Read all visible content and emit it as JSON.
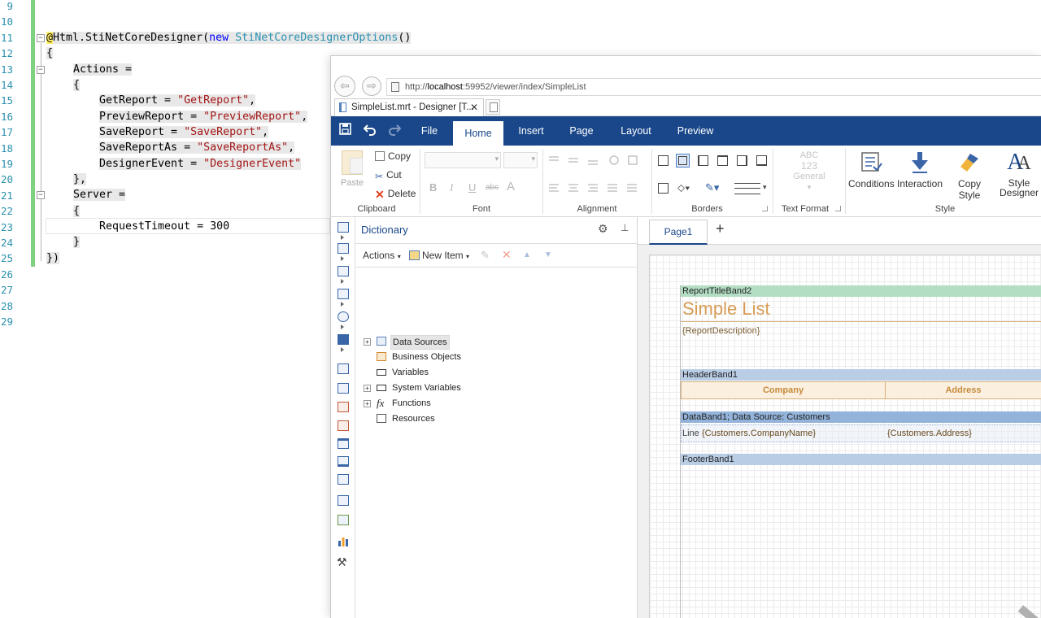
{
  "editor": {
    "line_numbers": [
      "9",
      "10",
      "11",
      "12",
      "13",
      "14",
      "15",
      "16",
      "17",
      "18",
      "19",
      "20",
      "21",
      "22",
      "23",
      "24",
      "25",
      "26",
      "27",
      "28",
      "29"
    ],
    "code": {
      "l11_at": "@",
      "l11_a": "Html.",
      "l11_b": "StiNetCoreDesigner",
      "l11_c": "(",
      "l11_new": "new",
      "l11_type": "StiNetCoreDesignerOptions",
      "l11_end": "()",
      "l12": "{",
      "l13": "Actions =",
      "l14": "{",
      "l15_k": "GetReport = ",
      "l15_v": "\"GetReport\"",
      "l15_e": ",",
      "l16_k": "PreviewReport = ",
      "l16_v": "\"PreviewReport\"",
      "l16_e": ",",
      "l17_k": "SaveReport = ",
      "l17_v": "\"SaveReport\"",
      "l17_e": ",",
      "l18_k": "SaveReportAs = ",
      "l18_v": "\"SaveReportAs\"",
      "l18_e": ",",
      "l19_k": "DesignerEvent = ",
      "l19_v": "\"DesignerEvent\"",
      "l20": "},",
      "l21": "Server =",
      "l22": "{",
      "l23": "RequestTimeout = 300",
      "l24": "}",
      "l25": "})"
    }
  },
  "browser": {
    "url_prefix": "http://",
    "url_host": "localhost",
    "url_rest": ":59952/viewer/index/SimpleList",
    "tab_title": "SimpleList.mrt - Designer [T...",
    "tab_close": "✕",
    "back_glyph": "⇦",
    "forward_glyph": "⇨"
  },
  "ribbon": {
    "tabs": [
      "File",
      "Home",
      "Insert",
      "Page",
      "Layout",
      "Preview"
    ],
    "active_tab": "Home",
    "accent_color": "#19478a",
    "clipboard": {
      "paste": "Paste",
      "copy": "Copy",
      "cut": "Cut",
      "delete": "Delete",
      "label": "Clipboard"
    },
    "font": {
      "bold": "B",
      "italic": "I",
      "underline": "U",
      "strike": "abc",
      "color_a": "A",
      "label": "Font"
    },
    "alignment_label": "Alignment",
    "borders_label": "Borders",
    "text_format": {
      "abc": "ABC",
      "num": "123",
      "general": "General",
      "label": "Text Format"
    },
    "style": {
      "conditions": "Conditions",
      "interaction": "Interaction",
      "copy_style": "Copy Style",
      "style_designer_1": "Style",
      "style_designer_2": "Designer",
      "label": "Style"
    }
  },
  "dictionary": {
    "title": "Dictionary",
    "actions": "Actions",
    "new_item": "New Item",
    "tree": [
      {
        "label": "Data Sources",
        "expandable": true,
        "selected": true
      },
      {
        "label": "Business Objects",
        "expandable": false,
        "selected": false
      },
      {
        "label": "Variables",
        "expandable": false,
        "selected": false
      },
      {
        "label": "System Variables",
        "expandable": true,
        "selected": false
      },
      {
        "label": "Functions",
        "expandable": true,
        "selected": false
      },
      {
        "label": "Resources",
        "expandable": false,
        "selected": false
      }
    ],
    "fx_glyph": "fx"
  },
  "design": {
    "page_tab": "Page1",
    "add_page": "+",
    "bands": {
      "report_title": "ReportTitleBand2",
      "title_text": "Simple List",
      "description": "{ReportDescription}",
      "header": "HeaderBand1",
      "col_company": "Company",
      "col_address": "Address",
      "data": "DataBand1; Data Source: Customers",
      "cell_line": "Line",
      "cell_company": "{Customers.CompanyName}",
      "cell_address": "{Customers.Address}",
      "footer": "FooterBand1"
    }
  }
}
